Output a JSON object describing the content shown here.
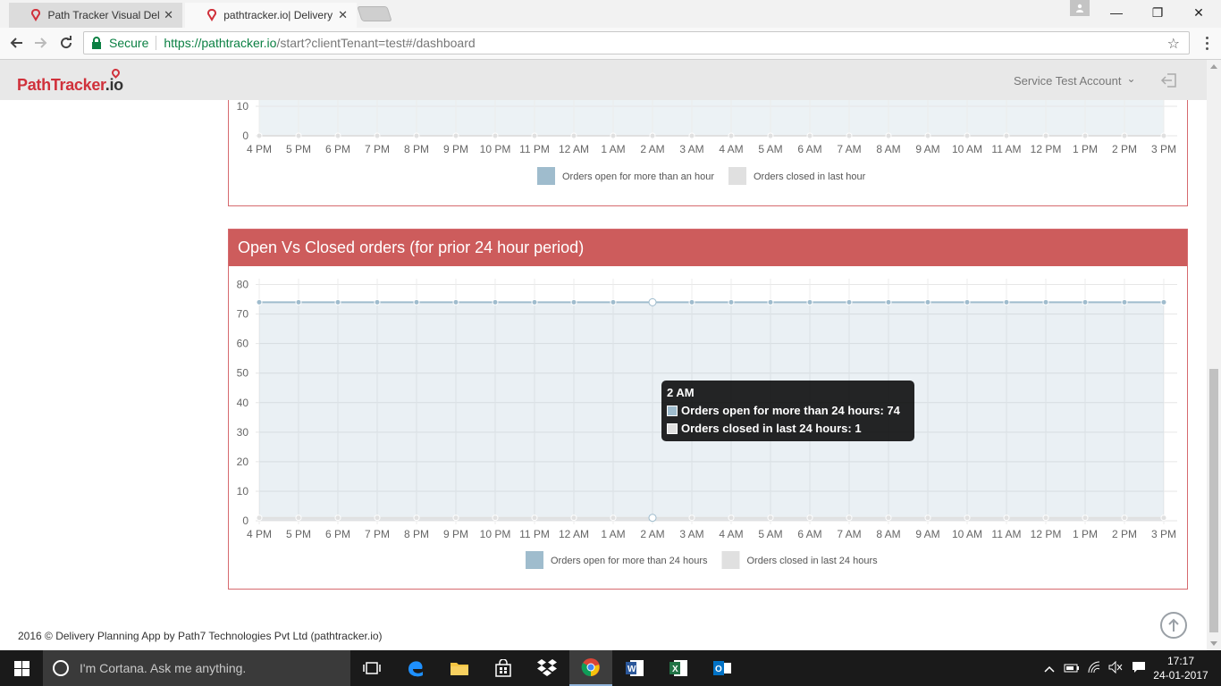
{
  "browser": {
    "tabs": [
      {
        "title": "Path Tracker Visual Delive",
        "close": "✕",
        "active": false
      },
      {
        "title": "pathtracker.io| Delivery P",
        "close": "✕",
        "active": true
      }
    ],
    "window_controls": {
      "minimize": "—",
      "restore": "❐",
      "close": "✕"
    },
    "secure_label": "Secure",
    "url_host": "https://pathtracker.io",
    "url_path": "/start?clientTenant=test#/dashboard"
  },
  "app": {
    "logo_path": "Path",
    "logo_tracker": "Tracker",
    "logo_io": ".io",
    "account_name": "Service Test Account",
    "account_caret": "⌄"
  },
  "panel2": {
    "title": "Open Vs Closed orders (for prior 24 hour period)"
  },
  "tooltip": {
    "title": "2 AM",
    "rows": [
      {
        "text": "Orders open for more than 24 hours: 74",
        "color": "#9fbccd"
      },
      {
        "text": "Orders closed in last 24 hours: 1",
        "color": "#e0e0e0"
      }
    ]
  },
  "chart_data": [
    {
      "type": "line",
      "title": "",
      "categories": [
        "4 PM",
        "5 PM",
        "6 PM",
        "7 PM",
        "8 PM",
        "9 PM",
        "10 PM",
        "11 PM",
        "12 AM",
        "1 AM",
        "2 AM",
        "3 AM",
        "4 AM",
        "5 AM",
        "6 AM",
        "7 AM",
        "8 AM",
        "9 AM",
        "10 AM",
        "11 AM",
        "12 PM",
        "1 PM",
        "2 PM",
        "3 PM"
      ],
      "yticks": [
        0,
        10
      ],
      "series": [
        {
          "name": "Orders open for more than an hour",
          "color": "#9fbccd"
        },
        {
          "name": "Orders closed in last hour",
          "color": "#e0e0e0",
          "values": [
            0,
            0,
            0,
            0,
            0,
            0,
            0,
            0,
            0,
            0,
            0,
            0,
            0,
            0,
            0,
            0,
            0,
            0,
            0,
            0,
            0,
            0,
            0,
            0
          ]
        }
      ],
      "legend": "bottom",
      "grid": true
    },
    {
      "type": "area",
      "title": "Open Vs Closed orders (for prior 24 hour period)",
      "categories": [
        "4 PM",
        "5 PM",
        "6 PM",
        "7 PM",
        "8 PM",
        "9 PM",
        "10 PM",
        "11 PM",
        "12 AM",
        "1 AM",
        "2 AM",
        "3 AM",
        "4 AM",
        "5 AM",
        "6 AM",
        "7 AM",
        "8 AM",
        "9 AM",
        "10 AM",
        "11 AM",
        "12 PM",
        "1 PM",
        "2 PM",
        "3 PM"
      ],
      "ylim": [
        0,
        80
      ],
      "yticks": [
        0,
        10,
        20,
        30,
        40,
        50,
        60,
        70,
        80
      ],
      "series": [
        {
          "name": "Orders open for more than 24 hours",
          "color": "#9fbccd",
          "values": [
            74,
            74,
            74,
            74,
            74,
            74,
            74,
            74,
            74,
            74,
            74,
            74,
            74,
            74,
            74,
            74,
            74,
            74,
            74,
            74,
            74,
            74,
            74,
            74
          ]
        },
        {
          "name": "Orders closed in last 24 hours",
          "color": "#e0e0e0",
          "values": [
            1,
            1,
            1,
            1,
            1,
            1,
            1,
            1,
            1,
            1,
            1,
            1,
            1,
            1,
            1,
            1,
            1,
            1,
            1,
            1,
            1,
            1,
            1,
            1
          ]
        }
      ],
      "legend": "bottom",
      "grid": true
    }
  ],
  "footer": {
    "text": "2016 © Delivery Planning App by Path7 Technologies Pvt Ltd (pathtracker.io)"
  },
  "taskbar": {
    "cortana_placeholder": "I'm Cortana. Ask me anything.",
    "time": "17:17",
    "date": "24-01-2017"
  }
}
